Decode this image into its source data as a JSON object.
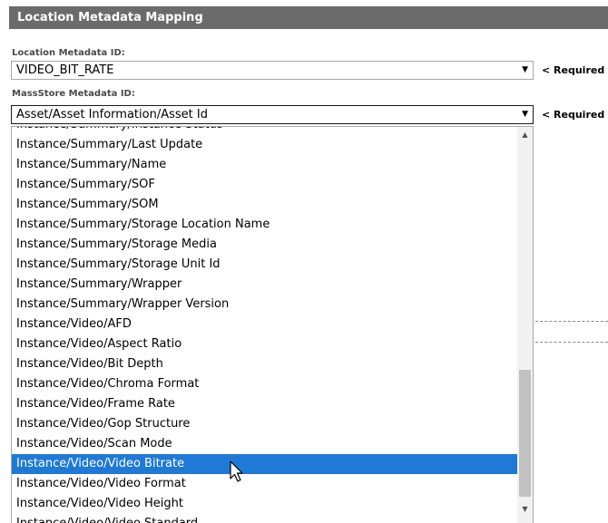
{
  "header": {
    "title": "Location Metadata Mapping"
  },
  "location_field": {
    "label": "Location Metadata ID:",
    "value": "VIDEO_BIT_RATE",
    "required": "< Required"
  },
  "massstore_field": {
    "label": "MassStore Metadata ID:",
    "value": "Asset/Asset Information/Asset Id",
    "required": "< Required"
  },
  "dropdown": {
    "items": [
      "Instance/Summary/Instance Status",
      "Instance/Summary/Last Update",
      "Instance/Summary/Name",
      "Instance/Summary/SOF",
      "Instance/Summary/SOM",
      "Instance/Summary/Storage Location Name",
      "Instance/Summary/Storage Media",
      "Instance/Summary/Storage Unit Id",
      "Instance/Summary/Wrapper",
      "Instance/Summary/Wrapper Version",
      "Instance/Video/AFD",
      "Instance/Video/Aspect Ratio",
      "Instance/Video/Bit Depth",
      "Instance/Video/Chroma Format",
      "Instance/Video/Frame Rate",
      "Instance/Video/Gop Structure",
      "Instance/Video/Scan Mode",
      "Instance/Video/Video Bitrate",
      "Instance/Video/Video Format",
      "Instance/Video/Video Height",
      "Instance/Video/Video Standard"
    ],
    "selected_index": 17
  },
  "icons": {
    "select_arrow": "dropdown-arrow-icon",
    "scroll_up": "scroll-up-arrow-icon",
    "scroll_down": "scroll-down-arrow-icon",
    "cursor": "mouse-pointer-icon"
  },
  "colors": {
    "header_bg": "#6b6b6b",
    "selected_bg": "#1e7ad6",
    "selected_text": "#ffffff"
  }
}
